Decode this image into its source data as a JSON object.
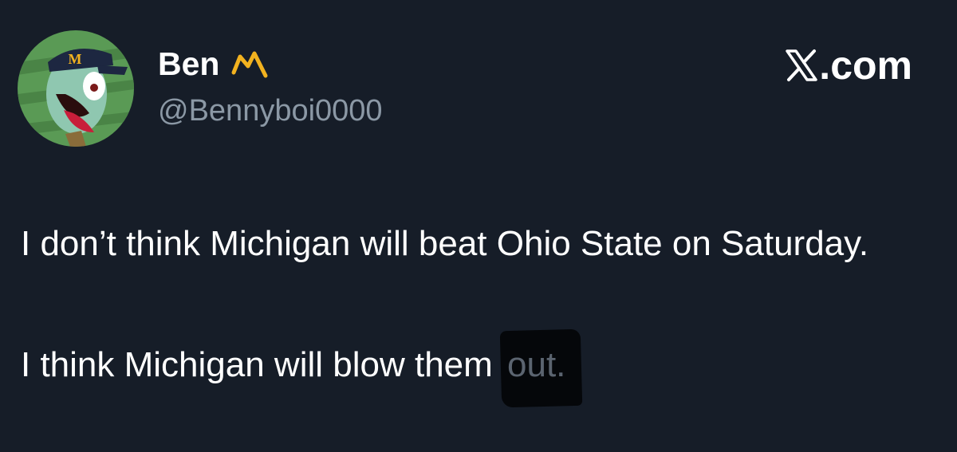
{
  "author": {
    "display_name": "Ben",
    "handle": "@Bennyboi0000",
    "badge_icon": "michigan-m-icon",
    "badge_color": "#f2b21f"
  },
  "avatar": {
    "icon": "squidward-michigan-hat-avatar",
    "hat_letter": "M"
  },
  "brand": {
    "label": ".com",
    "icon": "x-logo-icon"
  },
  "tweet": {
    "paragraph_1": "I don’t think Michigan will beat Ohio State on Saturday.",
    "paragraph_2_prefix": "I think Michigan will blow them ",
    "paragraph_2_scribbled": "out."
  },
  "colors": {
    "background": "#161d28",
    "text": "#ffffff",
    "secondary_text": "#8b98a5"
  }
}
